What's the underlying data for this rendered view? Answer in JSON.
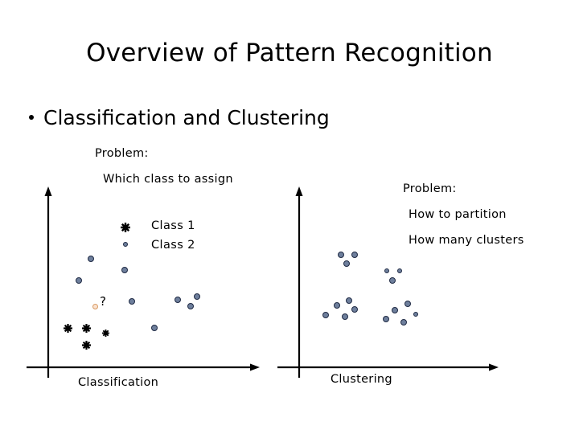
{
  "slide": {
    "title": "Overview of Pattern Recognition",
    "bullet": "Classification and Clustering",
    "background_color": "#ffffff",
    "text_color": "#000000"
  },
  "left_panel": {
    "problem_label": "Problem:",
    "question": "Which class to assign",
    "caption": "Classification",
    "unknown_marker_label": "?",
    "legend": [
      {
        "label": "Class 1",
        "marker": "black-star",
        "color": "#000000"
      },
      {
        "label": "Class 2",
        "marker": "blue-dot",
        "color": "#6e7f9c"
      }
    ]
  },
  "right_panel": {
    "problem_label": "Problem:",
    "questions": [
      "How to partition",
      "How many clusters"
    ],
    "caption": "Clustering"
  },
  "chart_data": [
    {
      "type": "scatter",
      "name": "classification",
      "title": "Classification",
      "xlabel": "Classification",
      "ylabel": "",
      "grid": false,
      "legend_position": "top-right-inside",
      "axis_style": "arrow-axes",
      "xlim": [
        0,
        100
      ],
      "ylim": [
        0,
        100
      ],
      "series": [
        {
          "name": "Class 1",
          "marker": "black-star",
          "color": "#000000",
          "points": [
            {
              "x": 10,
              "y": 25
            },
            {
              "x": 21,
              "y": 25
            },
            {
              "x": 32,
              "y": 23
            },
            {
              "x": 21,
              "y": 16
            }
          ]
        },
        {
          "name": "Class 2",
          "marker": "blue-dot",
          "color": "#6e7f9c",
          "points": [
            {
              "x": 23,
              "y": 71
            },
            {
              "x": 49,
              "y": 63
            },
            {
              "x": 16,
              "y": 58
            },
            {
              "x": 52,
              "y": 44
            },
            {
              "x": 76,
              "y": 46
            },
            {
              "x": 88,
              "y": 48
            },
            {
              "x": 84,
              "y": 41
            },
            {
              "x": 63,
              "y": 25
            }
          ]
        },
        {
          "name": "Unknown",
          "marker": "open-circle",
          "color": "#d79a63",
          "points": [
            {
              "x": 29,
              "y": 44
            }
          ]
        }
      ]
    },
    {
      "type": "scatter",
      "name": "clustering",
      "title": "Clustering",
      "xlabel": "Clustering",
      "ylabel": "",
      "grid": false,
      "legend_position": "none",
      "axis_style": "arrow-axes",
      "xlim": [
        0,
        100
      ],
      "ylim": [
        0,
        100
      ],
      "clusters": [
        {
          "name": "cluster-top-left",
          "points": [
            {
              "x": 25,
              "y": 63
            },
            {
              "x": 32,
              "y": 63
            },
            {
              "x": 28,
              "y": 58
            }
          ]
        },
        {
          "name": "cluster-top-right",
          "points": [
            {
              "x": 50,
              "y": 54
            },
            {
              "x": 57,
              "y": 54
            },
            {
              "x": 53,
              "y": 49
            }
          ]
        },
        {
          "name": "cluster-bottom-left",
          "points": [
            {
              "x": 28,
              "y": 39
            },
            {
              "x": 36,
              "y": 37
            },
            {
              "x": 39,
              "y": 33
            },
            {
              "x": 22,
              "y": 30
            },
            {
              "x": 32,
              "y": 29
            }
          ]
        },
        {
          "name": "cluster-bottom-right",
          "points": [
            {
              "x": 64,
              "y": 36
            },
            {
              "x": 57,
              "y": 32
            },
            {
              "x": 69,
              "y": 30
            },
            {
              "x": 52,
              "y": 27
            },
            {
              "x": 61,
              "y": 25
            }
          ]
        }
      ]
    }
  ]
}
